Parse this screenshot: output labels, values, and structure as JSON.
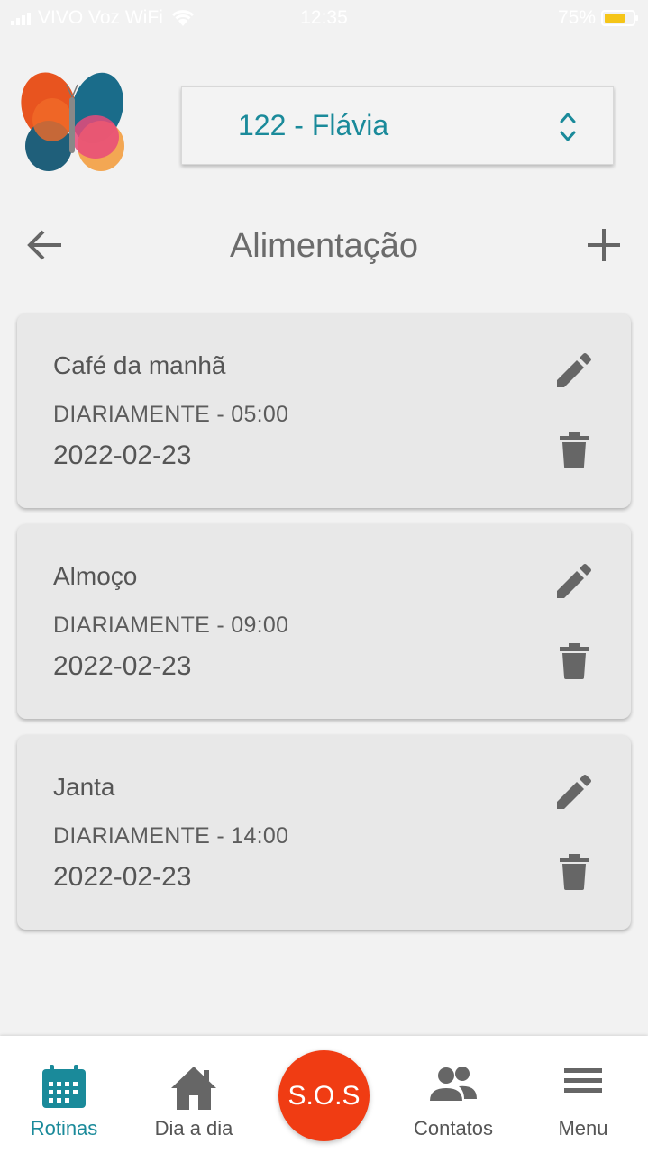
{
  "status_bar": {
    "carrier": "VIVO Voz WiFi",
    "time": "12:35",
    "battery": "75%"
  },
  "patient_select": {
    "value": "122 - Flávia"
  },
  "page": {
    "title": "Alimentação"
  },
  "routines": [
    {
      "name": "Café da manhã",
      "frequency": "DIARIAMENTE - 05:00",
      "date": "2022-02-23"
    },
    {
      "name": "Almoço",
      "frequency": "DIARIAMENTE - 09:00",
      "date": "2022-02-23"
    },
    {
      "name": "Janta",
      "frequency": "DIARIAMENTE - 14:00",
      "date": "2022-02-23"
    }
  ],
  "bottom_nav": {
    "rotinas": "Rotinas",
    "dia_a_dia": "Dia a dia",
    "sos": "S.O.S",
    "contatos": "Contatos",
    "menu": "Menu"
  },
  "colors": {
    "accent": "#1a8a9a",
    "sos": "#f03c13",
    "card_bg": "#e8e8e8",
    "background": "#f2f2f2"
  },
  "icons": {
    "back": "arrow-left-icon",
    "add": "plus-icon",
    "edit": "pencil-icon",
    "delete": "trash-icon",
    "rotinas": "calendar-icon",
    "dia_a_dia": "home-icon",
    "contatos": "people-icon",
    "menu": "hamburger-icon"
  }
}
